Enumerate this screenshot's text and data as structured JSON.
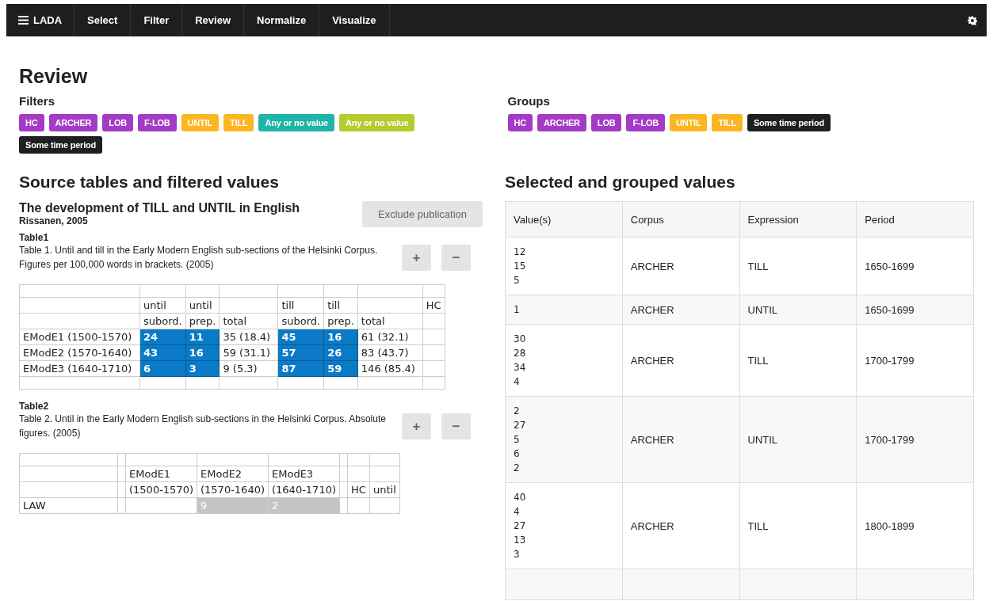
{
  "navbar": {
    "brand": "LADA",
    "items": [
      {
        "label": "Select",
        "selected": false
      },
      {
        "label": "Filter",
        "selected": false
      },
      {
        "label": "Review",
        "selected": false
      },
      {
        "label": "Normalize",
        "selected": false
      },
      {
        "label": "Visualize",
        "selected": false
      }
    ]
  },
  "page_title": "Review",
  "filters": {
    "title": "Filters",
    "tags": [
      {
        "label": "HC",
        "color": "#a43bc6"
      },
      {
        "label": "ARCHER",
        "color": "#a43bc6"
      },
      {
        "label": "LOB",
        "color": "#a43bc6"
      },
      {
        "label": "F-LOB",
        "color": "#a43bc6"
      },
      {
        "label": "UNTIL",
        "color": "#fbb622"
      },
      {
        "label": "TILL",
        "color": "#fbb622"
      },
      {
        "label": "Any or no value",
        "color": "#1eb4a8"
      },
      {
        "label": "Any or no value",
        "color": "#b5cc2c"
      },
      {
        "label": "Some time period",
        "color": "#1d1f21"
      }
    ]
  },
  "groups": {
    "title": "Groups",
    "tags": [
      {
        "label": "HC",
        "color": "#a43bc6"
      },
      {
        "label": "ARCHER",
        "color": "#a43bc6"
      },
      {
        "label": "LOB",
        "color": "#a43bc6"
      },
      {
        "label": "F-LOB",
        "color": "#a43bc6"
      },
      {
        "label": "UNTIL",
        "color": "#fbb622"
      },
      {
        "label": "TILL",
        "color": "#fbb622"
      },
      {
        "label": "Some time period",
        "color": "#1d1f21"
      }
    ]
  },
  "source": {
    "title": "Source tables and filtered values",
    "publication": {
      "title": "The development of TILL and UNTIL in English",
      "author": "Rissanen, 2005",
      "exclude_button": "Exclude publication"
    },
    "tables": [
      {
        "name": "Table1",
        "caption": "Table 1. Until and till in the Early Modern English sub-sections of the Helsinki Corpus. Figures per 100,000 words in brackets. (2005)",
        "plus": "+",
        "minus": "−",
        "rows": [
          [
            {
              "kind": "plain"
            },
            {
              "kind": "plain"
            },
            {
              "kind": "plain"
            },
            {
              "kind": "plain"
            },
            {
              "kind": "plain"
            },
            {
              "kind": "plain"
            },
            {
              "kind": "plain"
            },
            {
              "kind": "plain"
            }
          ],
          [
            {
              "kind": "plain"
            },
            {
              "kind": "plain",
              "text": "until"
            },
            {
              "kind": "plain",
              "text": "until"
            },
            {
              "kind": "plain"
            },
            {
              "kind": "plain",
              "text": "till"
            },
            {
              "kind": "plain",
              "text": "till"
            },
            {
              "kind": "plain"
            },
            {
              "kind": "plain",
              "text": "HC"
            }
          ],
          [
            {
              "kind": "plain"
            },
            {
              "kind": "plain",
              "text": "subord."
            },
            {
              "kind": "plain",
              "text": "prep."
            },
            {
              "kind": "plain",
              "text": "total"
            },
            {
              "kind": "plain",
              "text": "subord."
            },
            {
              "kind": "plain",
              "text": "prep."
            },
            {
              "kind": "plain",
              "text": "total"
            },
            {
              "kind": "plain"
            }
          ],
          [
            {
              "kind": "plain",
              "text": "EModE1 (1500-1570)"
            },
            {
              "kind": "selected",
              "text": "24"
            },
            {
              "kind": "selected",
              "text": "11"
            },
            {
              "kind": "plain",
              "text": "35 (18.4)"
            },
            {
              "kind": "selected",
              "text": "45"
            },
            {
              "kind": "selected",
              "text": "16"
            },
            {
              "kind": "plain",
              "text": "61 (32.1)"
            },
            {
              "kind": "plain"
            }
          ],
          [
            {
              "kind": "plain",
              "text": "EModE2 (1570-1640)"
            },
            {
              "kind": "selected",
              "text": "43"
            },
            {
              "kind": "selected",
              "text": "16"
            },
            {
              "kind": "plain",
              "text": "59 (31.1)"
            },
            {
              "kind": "selected",
              "text": "57"
            },
            {
              "kind": "selected",
              "text": "26"
            },
            {
              "kind": "plain",
              "text": "83 (43.7)"
            },
            {
              "kind": "plain"
            }
          ],
          [
            {
              "kind": "plain",
              "text": "EModE3 (1640-1710)"
            },
            {
              "kind": "selected",
              "text": "6"
            },
            {
              "kind": "selected",
              "text": "3"
            },
            {
              "kind": "plain",
              "text": "9 (5.3)"
            },
            {
              "kind": "selected",
              "text": "87"
            },
            {
              "kind": "selected",
              "text": "59"
            },
            {
              "kind": "plain",
              "text": "146 (85.4)"
            },
            {
              "kind": "plain"
            }
          ],
          [
            {
              "kind": "plain"
            },
            {
              "kind": "plain"
            },
            {
              "kind": "plain"
            },
            {
              "kind": "plain"
            },
            {
              "kind": "plain"
            },
            {
              "kind": "plain"
            },
            {
              "kind": "plain"
            },
            {
              "kind": "plain"
            }
          ]
        ]
      },
      {
        "name": "Table2",
        "caption": "Table 2. Until in the Early Modern English sub-sections in the Helsinki Corpus. Absolute figures. (2005)",
        "plus": "+",
        "minus": "−",
        "rows": [
          [
            {
              "kind": "plain"
            },
            {
              "kind": "plain"
            },
            {
              "kind": "plain"
            },
            {
              "kind": "plain"
            },
            {
              "kind": "plain"
            },
            {
              "kind": "plain"
            },
            {
              "kind": "plain"
            },
            {
              "kind": "plain"
            }
          ],
          [
            {
              "kind": "plain"
            },
            {
              "kind": "plain"
            },
            {
              "kind": "plain",
              "text": "EModE1"
            },
            {
              "kind": "plain",
              "text": "EModE2"
            },
            {
              "kind": "plain",
              "text": "EModE3"
            },
            {
              "kind": "plain"
            },
            {
              "kind": "plain"
            },
            {
              "kind": "plain"
            }
          ],
          [
            {
              "kind": "plain"
            },
            {
              "kind": "plain"
            },
            {
              "kind": "plain",
              "text": "(1500-1570)"
            },
            {
              "kind": "plain",
              "text": "(1570-1640)"
            },
            {
              "kind": "plain",
              "text": "(1640-1710)"
            },
            {
              "kind": "plain"
            },
            {
              "kind": "plain",
              "text": "HC"
            },
            {
              "kind": "plain",
              "text": "until"
            }
          ],
          [
            {
              "kind": "plain",
              "text": "LAW"
            },
            {
              "kind": "plain"
            },
            {
              "kind": "plain"
            },
            {
              "kind": "muted",
              "text": "9"
            },
            {
              "kind": "muted",
              "text": "2"
            },
            {
              "kind": "plain"
            },
            {
              "kind": "plain"
            },
            {
              "kind": "plain"
            }
          ]
        ]
      }
    ]
  },
  "selected": {
    "title": "Selected and grouped values",
    "columns": [
      "Value(s)",
      "Corpus",
      "Expression",
      "Period"
    ],
    "rows": [
      {
        "values": "12\n15\n5",
        "corpus": "ARCHER",
        "expression": "TILL",
        "period": "1650-1699"
      },
      {
        "values": "1",
        "corpus": "ARCHER",
        "expression": "UNTIL",
        "period": "1650-1699"
      },
      {
        "values": "30\n28\n34\n4",
        "corpus": "ARCHER",
        "expression": "TILL",
        "period": "1700-1799"
      },
      {
        "values": "2\n27\n5\n6\n2",
        "corpus": "ARCHER",
        "expression": "UNTIL",
        "period": "1700-1799"
      },
      {
        "values": "40\n4\n27\n13\n3",
        "corpus": "ARCHER",
        "expression": "TILL",
        "period": "1800-1899"
      }
    ]
  }
}
